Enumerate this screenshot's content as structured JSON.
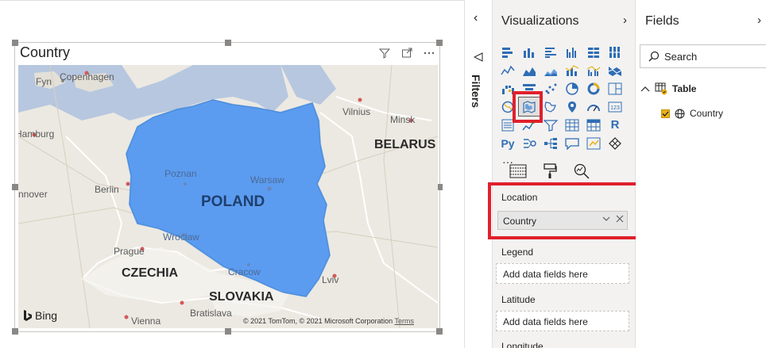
{
  "visual": {
    "title": "Country",
    "icons": [
      "filter-icon",
      "focus-mode-icon",
      "more-options-icon"
    ],
    "map": {
      "highlight_color": "#5b9cf0",
      "labels": {
        "fyn": "Fyn",
        "copenhagen": "Copenhagen",
        "hamburg": "Hamburg",
        "berlin": "Berlin",
        "hannover": "nnover",
        "poznan": "Poznan",
        "warsaw": "Warsaw",
        "poland": "POLAND",
        "wroclaw": "Wrocław",
        "prague": "Prague",
        "czechia": "CZECHIA",
        "cracow": "Cracow",
        "slovakia": "SLOVAKIA",
        "bratislava": "Bratislava",
        "vienna": "Vienna",
        "lviv": "Lviv",
        "vilnius": "Vilnius",
        "minsk": "Minsk",
        "belarus": "BELARUS"
      },
      "attribution": "© 2021 TomTom, © 2021 Microsoft Corporation",
      "terms_link": "Terms",
      "provider": "Bing"
    }
  },
  "filters_pane": {
    "label": "Filters",
    "collapse_icon": "chevron-left-icon"
  },
  "visualizations_pane": {
    "title": "Visualizations",
    "expand_icon": "chevron-right-icon",
    "selected_visual": "filled-map",
    "r_label": "R",
    "py_label": "Py",
    "more_label": "···",
    "wells": {
      "location": {
        "label": "Location",
        "field": "Country"
      },
      "legend": {
        "label": "Legend",
        "placeholder": "Add data fields here"
      },
      "latitude": {
        "label": "Latitude",
        "placeholder": "Add data fields here"
      },
      "longitude": {
        "label": "Longitude"
      }
    }
  },
  "fields_pane": {
    "title": "Fields",
    "search_placeholder": "Search",
    "table": {
      "name": "Table",
      "fields": [
        {
          "name": "Country",
          "checked": true
        }
      ]
    }
  },
  "colors": {
    "highlight_red": "#e0202c",
    "checkbox_yellow": "#e8b21a"
  }
}
